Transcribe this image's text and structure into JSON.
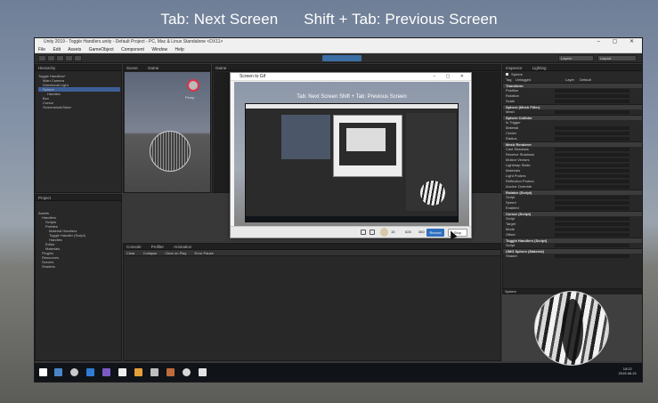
{
  "hint": {
    "next": "Tab: Next Screen",
    "previous": "Shift + Tab: Previous Screen"
  },
  "unity": {
    "title": "Unity 2019 - Toggle Handlers.unity - Default Project - PC, Mac & Linux Standalone <DX11>",
    "menu": [
      "File",
      "Edit",
      "Assets",
      "GameObject",
      "Component",
      "Window",
      "Help"
    ],
    "toolbar": {
      "layers": "Layers",
      "layout": "Layout"
    },
    "hierarchy": {
      "tab": "Hierarchy",
      "items": [
        "Toggle Handlers*",
        "Main Camera",
        "Directional Light",
        "Sphere",
        "Handles",
        "Box",
        "Cursor",
        "ScreenshotsTaker"
      ]
    },
    "scene": {
      "tabs": [
        "Scene",
        "Game"
      ],
      "persp": "Persp"
    },
    "game": {
      "tab": "Game"
    },
    "project": {
      "tab": "Project",
      "items": [
        "Assets",
        "Handlers",
        "Scripts",
        "Prefabs",
        "Material Handlers",
        "Toggle Handler (Script)",
        "Handles",
        "Editor",
        "Materials",
        "Plugins",
        "Resources",
        "Scenes",
        "Shaders"
      ]
    },
    "console": {
      "tabs": [
        "Console",
        "Profiler",
        "Animation"
      ],
      "buttons": [
        "Clear",
        "Collapse",
        "Clear on Play",
        "Error Pause"
      ]
    },
    "inspector": {
      "tabs": [
        "Inspector",
        "Lighting"
      ],
      "object_name": "Sphere",
      "tag_label": "Tag",
      "tag_value": "Untagged",
      "layer_label": "Layer",
      "layer_value": "Default",
      "components": [
        {
          "name": "Transform",
          "rows": [
            "Position",
            "Rotation",
            "Scale"
          ]
        },
        {
          "name": "Sphere (Mesh Filter)",
          "rows": [
            "Mesh"
          ]
        },
        {
          "name": "Sphere Collider",
          "rows": [
            "Is Trigger",
            "Material",
            "Center",
            "Radius"
          ]
        },
        {
          "name": "Mesh Renderer",
          "rows": [
            "Cast Shadows",
            "Receive Shadows",
            "Motion Vectors",
            "Lightmap Static",
            "Materials",
            "Light Probes",
            "Reflection Probes",
            "Anchor Override"
          ]
        },
        {
          "name": "Rotator (Script)",
          "rows": [
            "Script",
            "Speed",
            "Enabled"
          ]
        },
        {
          "name": "Cursor (Script)",
          "rows": [
            "Script",
            "Target",
            "Mode",
            "Offset"
          ]
        },
        {
          "name": "Toggle Handlers (Script)",
          "rows": [
            "Script"
          ]
        },
        {
          "name": "UMG Sphere (Material)",
          "rows": [
            "Shader"
          ]
        }
      ],
      "footer": "Sphere"
    }
  },
  "dialog": {
    "title": "Screen to Gif",
    "caption": "Tab: Next Screen    Shift + Tab: Previous Screen",
    "fps": "15",
    "size_w": "628",
    "size_h": "360",
    "record_label": "Record",
    "stop_label": "Stop"
  },
  "taskbar": {
    "time": "15:22",
    "date": "2019-06-21"
  }
}
